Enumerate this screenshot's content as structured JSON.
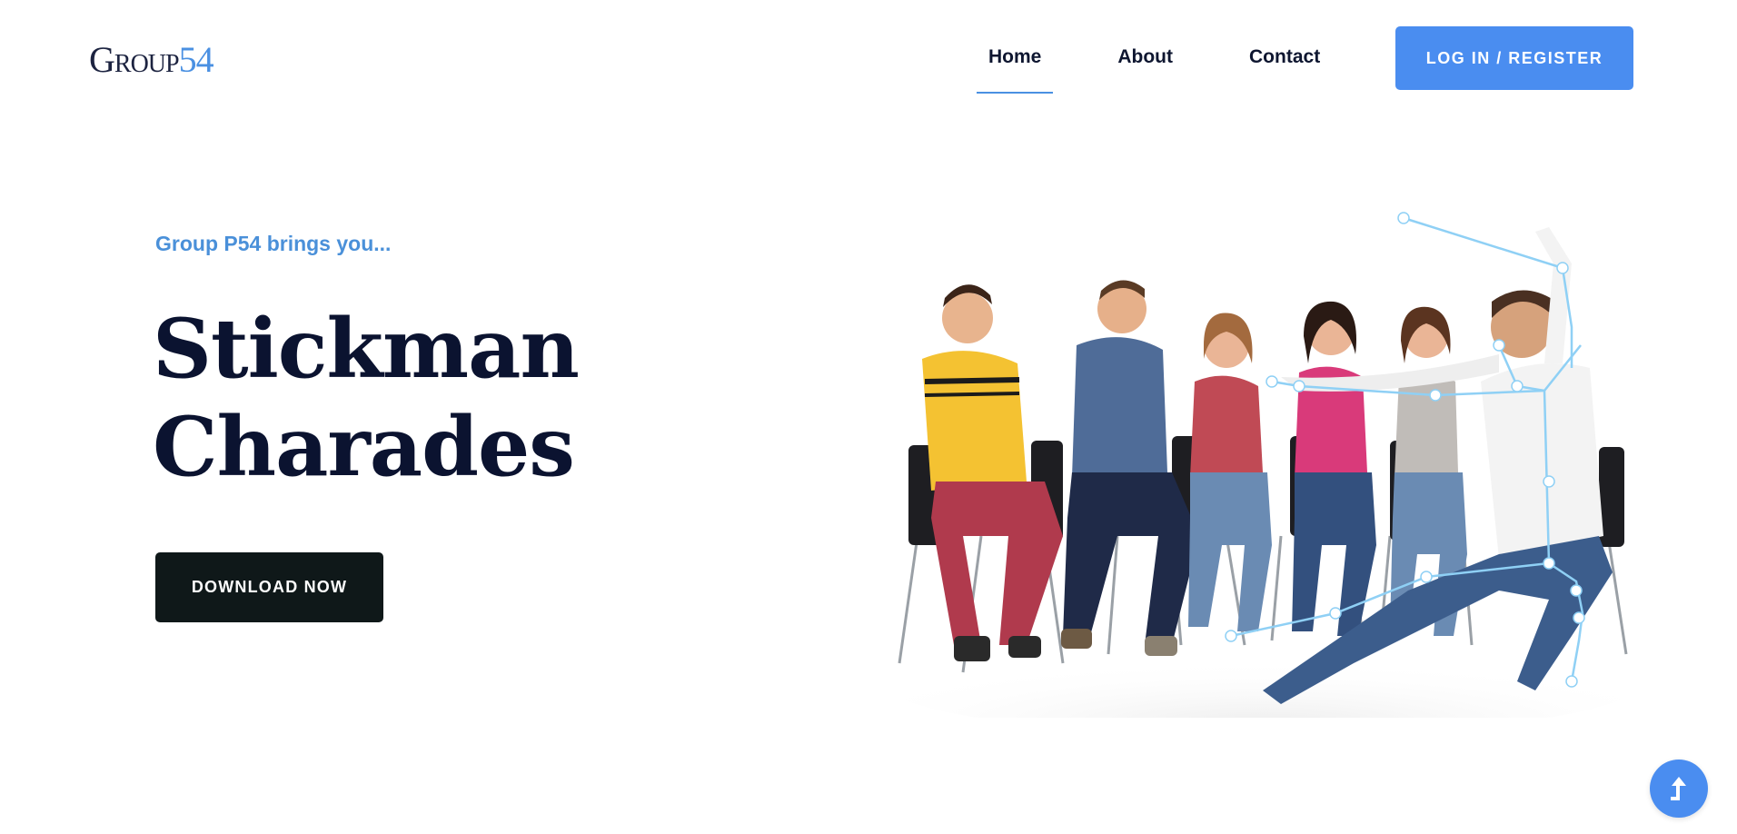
{
  "brand": {
    "logo_word": "Group",
    "logo_num": "54"
  },
  "nav": {
    "items": [
      {
        "label": "Home",
        "active": true
      },
      {
        "label": "About",
        "active": false
      },
      {
        "label": "Contact",
        "active": false
      }
    ],
    "login_label": "LOG IN / REGISTER"
  },
  "hero": {
    "eyebrow": "Group P54 brings you...",
    "title_line1": "Stickman",
    "title_line2": "Charades",
    "download_label": "DOWNLOAD NOW"
  },
  "icons": {
    "scroll_top": "arrow-up-icon"
  },
  "colors": {
    "accent": "#4a8df0",
    "title": "#0b1330",
    "eyebrow": "#4a90d9",
    "download_button": "#0f1819",
    "skeleton": "#8fd0f5"
  }
}
